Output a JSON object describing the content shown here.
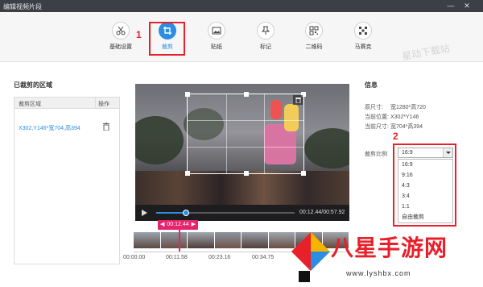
{
  "window": {
    "title": "编辑视频片段",
    "minimize_glyph": "—",
    "close_glyph": "✕"
  },
  "toolbar": {
    "tools": [
      {
        "label": "基础设置",
        "icon": "scissors-icon"
      },
      {
        "label": "裁剪",
        "icon": "crop-icon",
        "active": true
      },
      {
        "label": "贴纸",
        "icon": "image-icon"
      },
      {
        "label": "标记",
        "icon": "pin-icon"
      },
      {
        "label": "二维码",
        "icon": "qrcode-icon"
      },
      {
        "label": "马赛克",
        "icon": "mosaic-icon"
      }
    ],
    "marker_1": "1",
    "watermark": "星动下载站"
  },
  "left_panel": {
    "title": "已裁剪的区域",
    "columns": [
      "裁剪区域",
      "操作"
    ],
    "rows": [
      {
        "region": "X302,Y146*宽704,高394",
        "action_icon": "trash-icon"
      }
    ]
  },
  "player": {
    "time_readout": "00:12.44/00:57.92",
    "progress_fraction": 0.215,
    "timeline_current": "00:12.44",
    "timeline_ticks": [
      "00:00.00",
      "00:11.58",
      "00:23.16",
      "00:34.75"
    ]
  },
  "info": {
    "title": "信息",
    "source_size_label": "原尺寸:",
    "source_size_value": "宽1280*高720",
    "position_label": "当前位置:",
    "position_value": "X302*Y146",
    "current_size_label": "当前尺寸:",
    "current_size_value": "宽704*高394",
    "ratio_label": "裁剪比例",
    "ratio_selected": "16:9",
    "ratio_options": [
      "16:9",
      "9:16",
      "4:3",
      "3:4",
      "1:1",
      "自由裁剪"
    ],
    "marker_2": "2"
  },
  "brand": {
    "name": "八星手游网",
    "url": "www.lyshbx.com"
  },
  "colors": {
    "accent": "#2b8ee3",
    "highlight_red": "#e8202a",
    "timeline_pink": "#e8236d",
    "titlebar": "#3c3f46"
  }
}
